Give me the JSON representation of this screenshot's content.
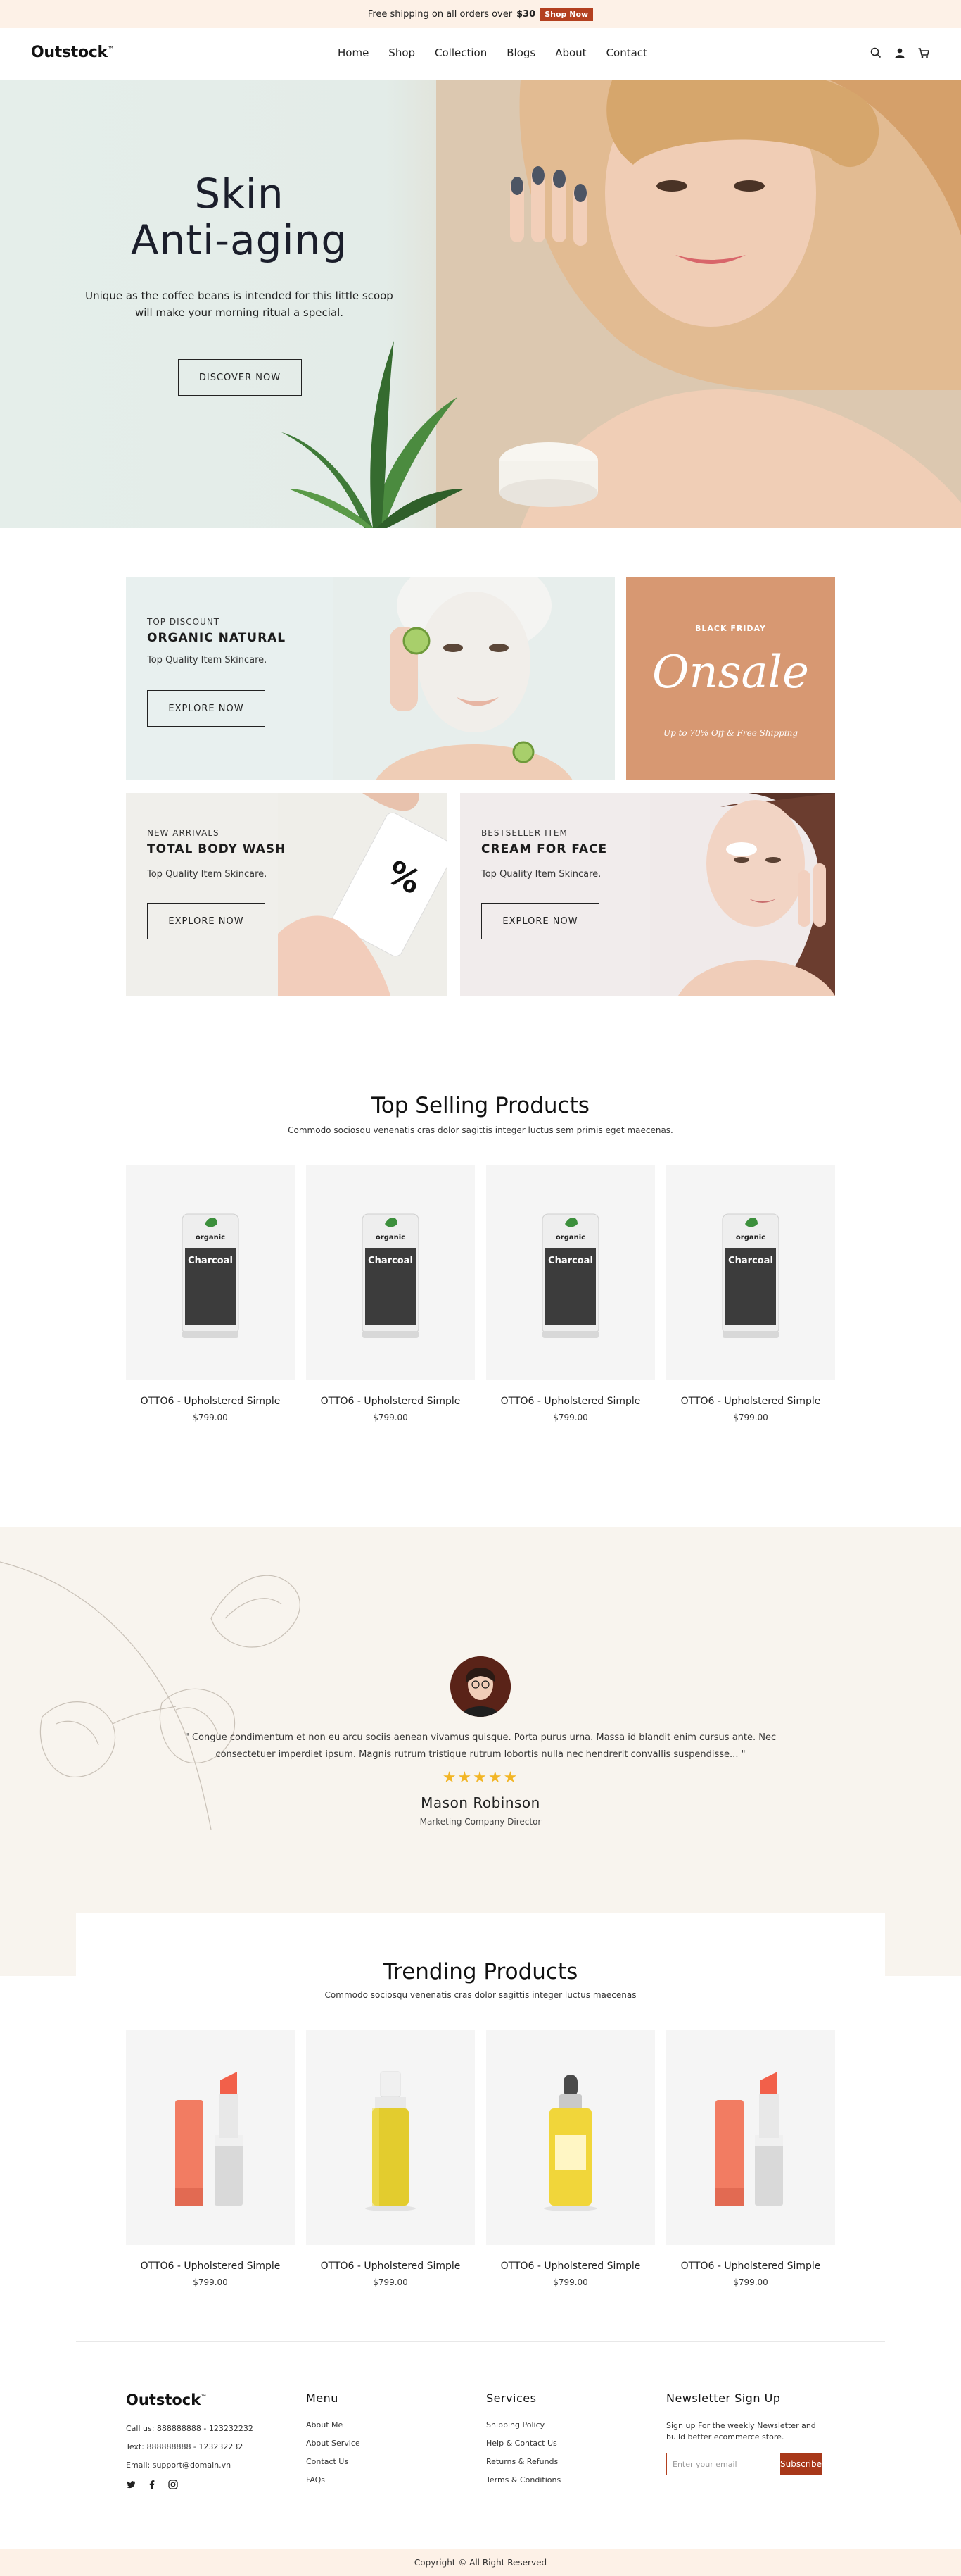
{
  "announcement": {
    "text_before": "Free shipping on all orders over",
    "price": "$30",
    "cta": "Shop Now"
  },
  "header": {
    "logo": "Outstock",
    "logo_mark": "™",
    "nav": [
      "Home",
      "Shop",
      "Collection",
      "Blogs",
      "About",
      "Contact"
    ],
    "icons": [
      "search-icon",
      "user-icon",
      "cart-icon"
    ]
  },
  "hero": {
    "title_line1": "Skin",
    "title_line2": "Anti-aging",
    "subtitle": "Unique as the coffee beans is intended for this little scoop will make your morning ritual a special.",
    "button": "DISCOVER NOW"
  },
  "banners": [
    {
      "eyebrow": "TOP DISCOUNT",
      "title": "ORGANIC NATURAL",
      "desc": "Top Quality Item Skincare.",
      "button": "EXPLORE NOW"
    },
    {
      "small": "BLACK FRIDAY",
      "big": "Onsale",
      "foot": "Up to 70% Off & Free Shipping"
    },
    {
      "eyebrow": "NEW ARRIVALS",
      "title": "TOTAL BODY WASH",
      "desc": "Top Quality Item Skincare.",
      "button": "EXPLORE NOW"
    },
    {
      "eyebrow": "BESTSELLER ITEM",
      "title": "CREAM FOR FACE",
      "desc": "Top Quality Item Skincare.",
      "button": "EXPLORE NOW"
    }
  ],
  "top_selling": {
    "title": "Top Selling Products",
    "subtitle": "Commodo sociosqu venenatis cras dolor sagittis integer luctus sem primis eget maecenas.",
    "products": [
      {
        "name": "OTTO6 - Upholstered Simple",
        "price": "$799.00",
        "label_brand": "organic",
        "label_name": "Charcoal"
      },
      {
        "name": "OTTO6 - Upholstered Simple",
        "price": "$799.00",
        "label_brand": "organic",
        "label_name": "Charcoal"
      },
      {
        "name": "OTTO6 - Upholstered Simple",
        "price": "$799.00",
        "label_brand": "organic",
        "label_name": "Charcoal"
      },
      {
        "name": "OTTO6 - Upholstered Simple",
        "price": "$799.00",
        "label_brand": "organic",
        "label_name": "Charcoal"
      }
    ]
  },
  "testimonial": {
    "quote": "\" Congue condimentum et non eu arcu sociis aenean vivamus quisque. Porta purus urna. Massa id blandit enim cursus ante. Nec consectetuer imperdiet ipsum. Magnis rutrum tristique rutrum lobortis nulla nec hendrerit convallis suspendisse... \"",
    "rating": 5,
    "stars": "★★★★★",
    "name": "Mason Robinson",
    "role": "Marketing Company Director"
  },
  "trending": {
    "title": "Trending Products",
    "subtitle": "Commodo sociosqu venenatis cras dolor sagittis integer luctus maecenas",
    "products": [
      {
        "name": "OTTO6 - Upholstered Simple",
        "price": "$799.00",
        "kind": "lipstick"
      },
      {
        "name": "OTTO6 - Upholstered Simple",
        "price": "$799.00",
        "kind": "oil-bottle"
      },
      {
        "name": "OTTO6 - Upholstered Simple",
        "price": "$799.00",
        "kind": "serum"
      },
      {
        "name": "OTTO6 - Upholstered Simple",
        "price": "$799.00",
        "kind": "lipstick"
      }
    ]
  },
  "footer": {
    "logo": "Outstock",
    "logo_mark": "™",
    "contact": [
      "Call us: 888888888 - 123232232",
      "Text: 888888888 - 123232232",
      "Email: support@domain.vn"
    ],
    "social": [
      "twitter-icon",
      "facebook-icon",
      "instagram-icon"
    ],
    "menu_title": "Menu",
    "menu": [
      "About Me",
      "About Service",
      "Contact Us",
      "FAQs"
    ],
    "services_title": "Services",
    "services": [
      "Shipping Policy",
      "Help & Contact Us",
      "Returns & Refunds",
      "Terms & Conditions"
    ],
    "newsletter_title": "Newsletter Sign Up",
    "newsletter_desc": "Sign up For the weekly Newsletter and build better ecommerce store.",
    "newsletter_placeholder": "Enter your email",
    "newsletter_button": "Subscribe",
    "copyright": "Copyright © All Right Reserved"
  },
  "colors": {
    "accent": "#b3401f",
    "announcement_bg": "#fdf1e7",
    "testimonial_bg": "#f8f4ee",
    "star": "#f2b525",
    "onsale_bg": "#d79872"
  }
}
